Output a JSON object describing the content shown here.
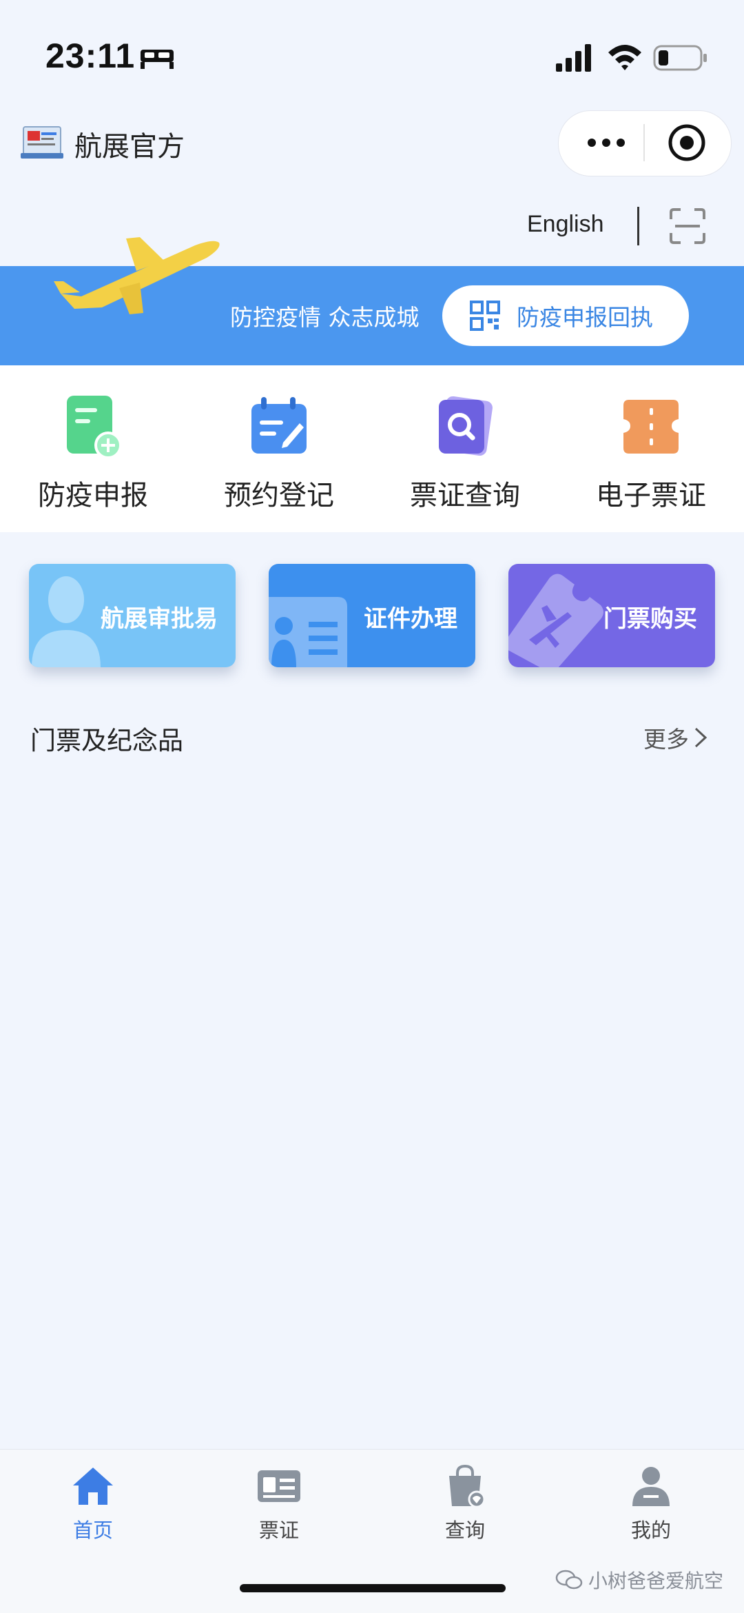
{
  "status_bar": {
    "time": "23:11"
  },
  "header": {
    "app_title": "航展官方",
    "logo_icon": "airshow-logo"
  },
  "toolbar": {
    "language_label": "English"
  },
  "banner": {
    "slogan": "防控疫情 众志成城",
    "button_label": "防疫申报回执",
    "color": "#4b97ef"
  },
  "quick_actions": [
    {
      "label": "防疫申报",
      "icon": "declaration-add-icon"
    },
    {
      "label": "预约登记",
      "icon": "calendar-edit-icon"
    },
    {
      "label": "票证查询",
      "icon": "search-ticket-icon"
    },
    {
      "label": "电子票证",
      "icon": "e-ticket-icon"
    }
  ],
  "cards": [
    {
      "label": "航展审批易",
      "color": "#78c4f7"
    },
    {
      "label": "证件办理",
      "color": "#3d90ee"
    },
    {
      "label": "门票购买",
      "color": "#7467e5"
    }
  ],
  "section": {
    "title": "门票及纪念品",
    "more_label": "更多"
  },
  "tabs": [
    {
      "label": "首页",
      "icon": "home-icon",
      "active": true
    },
    {
      "label": "票证",
      "icon": "id-card-icon",
      "active": false
    },
    {
      "label": "查询",
      "icon": "shopping-bag-icon",
      "active": false
    },
    {
      "label": "我的",
      "icon": "user-icon",
      "active": false
    }
  ],
  "watermark": {
    "text": "小树爸爸爱航空"
  },
  "colors": {
    "accent": "#3d7de4",
    "background": "#f1f5fd"
  }
}
